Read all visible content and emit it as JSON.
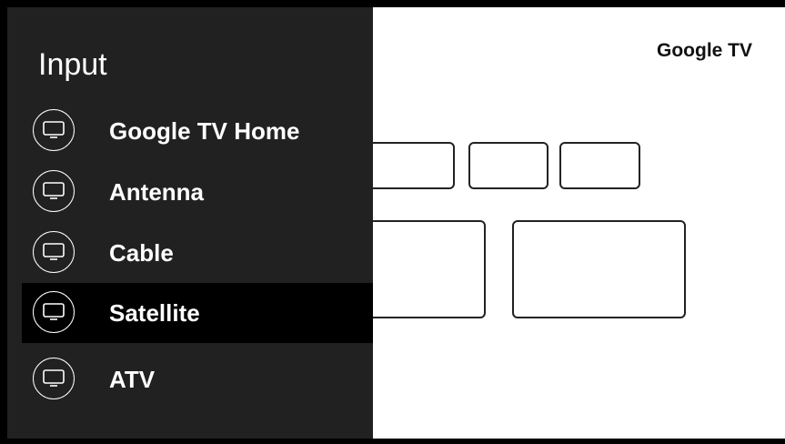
{
  "panel": {
    "title": "Input",
    "items": [
      {
        "label": "Google TV Home",
        "icon": "tv-icon",
        "selected": false
      },
      {
        "label": "Antenna",
        "icon": "tv-icon",
        "selected": false
      },
      {
        "label": "Cable",
        "icon": "tv-icon",
        "selected": false
      },
      {
        "label": "Satellite",
        "icon": "tv-icon",
        "selected": true
      },
      {
        "label": "ATV",
        "icon": "tv-icon",
        "selected": false
      }
    ]
  },
  "screen": {
    "brand": "Google TV"
  },
  "colors": {
    "panel_bg": "#212121",
    "selected_bg": "#000000",
    "screen_bg": "#ffffff"
  }
}
